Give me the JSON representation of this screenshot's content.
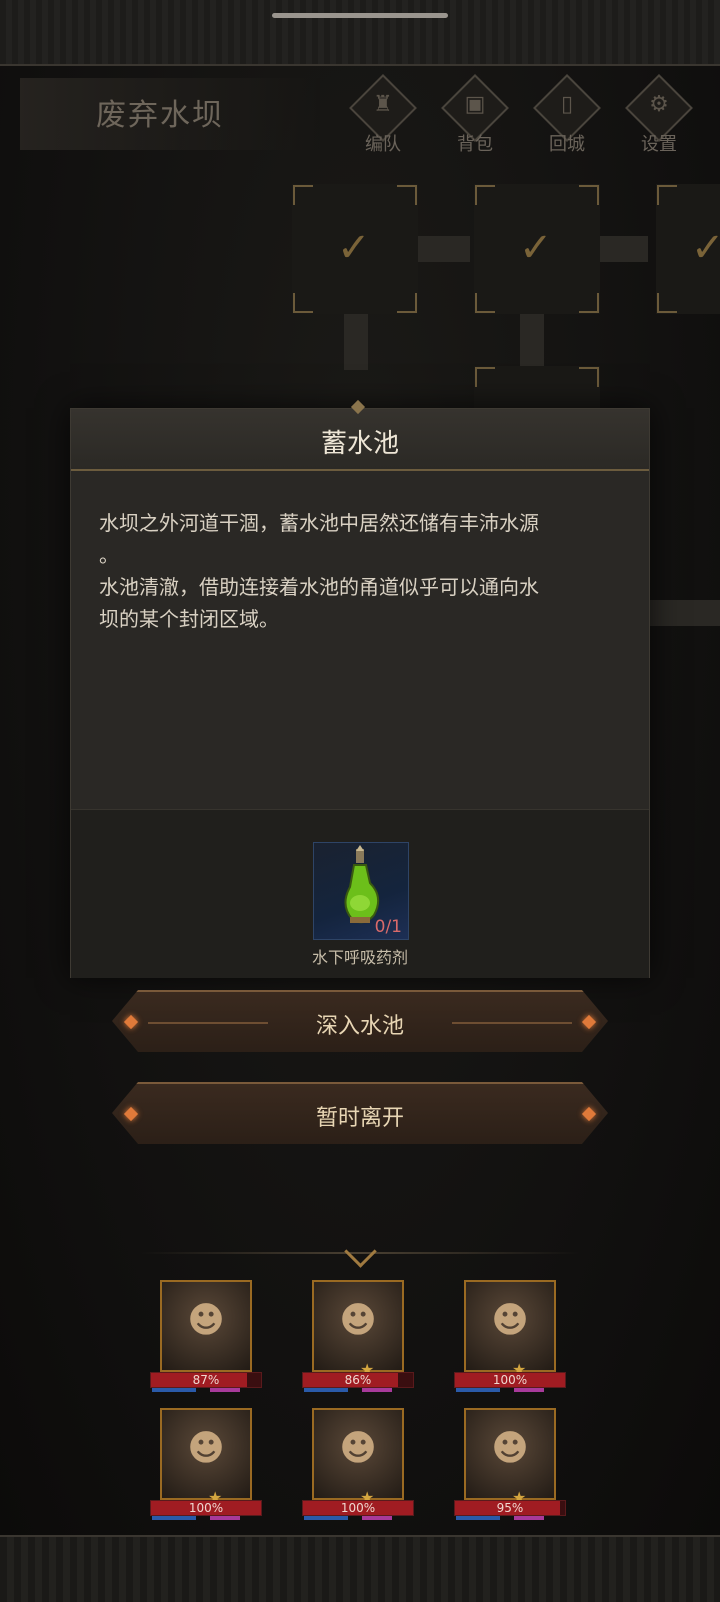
{
  "zone": {
    "title": "废弃水坝"
  },
  "top_menu": [
    {
      "label": "编队",
      "icon": "helmet-icon"
    },
    {
      "label": "背包",
      "icon": "backpack-icon"
    },
    {
      "label": "回城",
      "icon": "door-icon"
    },
    {
      "label": "设置",
      "icon": "gear-icon"
    }
  ],
  "map": {
    "cleared_rooms": 3
  },
  "dialog": {
    "title": "蓄水池",
    "body": "水坝之外河道干涸，蓄水池中居然还储有丰沛水源\n。\n水池清澈，借助连接着水池的甬道似乎可以通向水\n坝的某个封闭区域。",
    "required_item": {
      "name": "水下呼吸药剂",
      "count": "0/1",
      "icon": "potion-icon"
    }
  },
  "buttons": {
    "primary": "深入水池",
    "secondary": "暂时离开"
  },
  "party": [
    {
      "hp": "87%",
      "hp_value": 0.87,
      "icon": "warrior-portrait"
    },
    {
      "hp": "86%",
      "hp_value": 0.86,
      "icon": "druid-portrait"
    },
    {
      "hp": "100%",
      "hp_value": 1.0,
      "icon": "witch-portrait"
    },
    {
      "hp": "100%",
      "hp_value": 1.0,
      "icon": "priestess-portrait"
    },
    {
      "hp": "100%",
      "hp_value": 1.0,
      "icon": "knight-portrait"
    },
    {
      "hp": "95%",
      "hp_value": 0.95,
      "icon": "mage-portrait"
    }
  ],
  "colors": {
    "accent_gold": "#9a6a22",
    "hp_red": "#a01c22",
    "button_gem": "#e07a3a"
  }
}
